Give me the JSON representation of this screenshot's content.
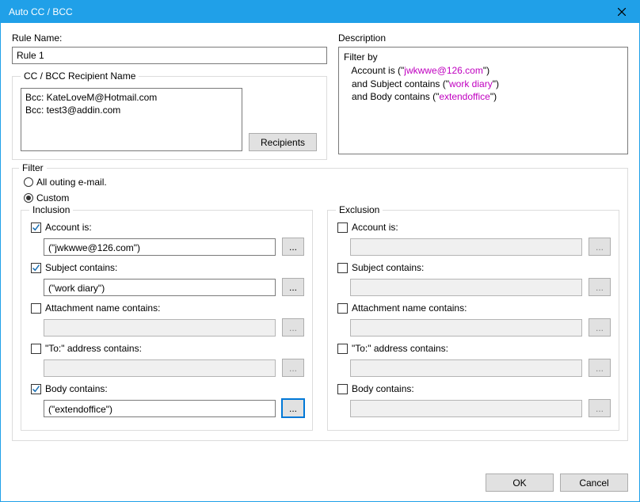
{
  "window": {
    "title": "Auto CC / BCC"
  },
  "ruleName": {
    "label": "Rule Name:",
    "value": "Rule 1"
  },
  "description": {
    "label": "Description",
    "intro": "Filter by",
    "lines": [
      {
        "prefix": "   Account is (\"",
        "quoted": "jwkwwe@126.com",
        "suffix": "\")"
      },
      {
        "prefix": "   and Subject contains (\"",
        "quoted": "work diary",
        "suffix": "\")"
      },
      {
        "prefix": "   and Body contains (\"",
        "quoted": "extendoffice",
        "suffix": "\")"
      }
    ]
  },
  "ccbcc": {
    "legend": "CC / BCC Recipient Name",
    "text": "Bcc: KateLoveM@Hotmail.com\nBcc: test3@addin.com",
    "recipientsBtn": "Recipients"
  },
  "filter": {
    "legend": "Filter",
    "allLabel": "All outing e-mail.",
    "customLabel": "Custom",
    "selected": "custom",
    "ellipsis": "...",
    "inclusion": {
      "legend": "Inclusion",
      "account": {
        "label": "Account is:",
        "checked": true,
        "value": "(\"jwkwwe@126.com\")"
      },
      "subject": {
        "label": "Subject contains:",
        "checked": true,
        "value": "(\"work diary\")"
      },
      "attachment": {
        "label": "Attachment name contains:",
        "checked": false,
        "value": ""
      },
      "to": {
        "label": "\"To:\" address contains:",
        "checked": false,
        "value": ""
      },
      "body": {
        "label": "Body contains:",
        "checked": true,
        "value": "(\"extendoffice\")",
        "focus": true
      }
    },
    "exclusion": {
      "legend": "Exclusion",
      "account": {
        "label": "Account is:",
        "checked": false,
        "value": ""
      },
      "subject": {
        "label": "Subject contains:",
        "checked": false,
        "value": ""
      },
      "attachment": {
        "label": "Attachment name contains:",
        "checked": false,
        "value": ""
      },
      "to": {
        "label": "\"To:\" address contains:",
        "checked": false,
        "value": ""
      },
      "body": {
        "label": "Body contains:",
        "checked": false,
        "value": ""
      }
    }
  },
  "footer": {
    "ok": "OK",
    "cancel": "Cancel"
  }
}
